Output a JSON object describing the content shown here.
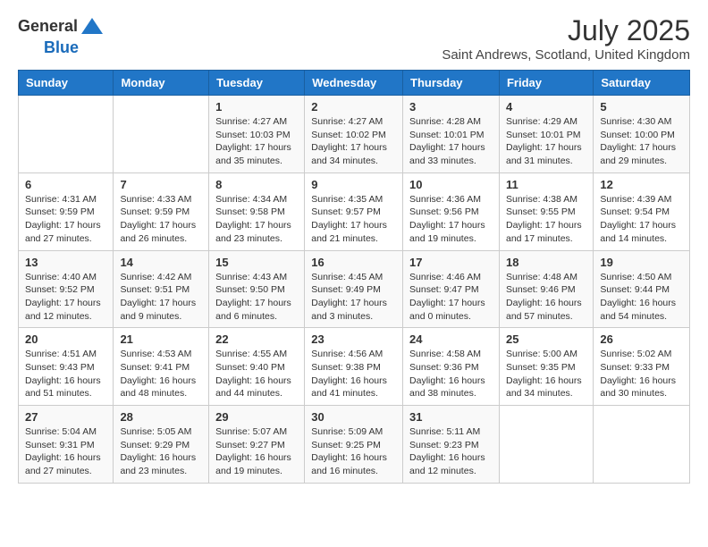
{
  "header": {
    "logo_general": "General",
    "logo_blue": "Blue",
    "month_title": "July 2025",
    "location": "Saint Andrews, Scotland, United Kingdom"
  },
  "calendar": {
    "days_of_week": [
      "Sunday",
      "Monday",
      "Tuesday",
      "Wednesday",
      "Thursday",
      "Friday",
      "Saturday"
    ],
    "weeks": [
      [
        {
          "day": "",
          "sunrise": "",
          "sunset": "",
          "daylight": ""
        },
        {
          "day": "",
          "sunrise": "",
          "sunset": "",
          "daylight": ""
        },
        {
          "day": "1",
          "sunrise": "Sunrise: 4:27 AM",
          "sunset": "Sunset: 10:03 PM",
          "daylight": "Daylight: 17 hours and 35 minutes."
        },
        {
          "day": "2",
          "sunrise": "Sunrise: 4:27 AM",
          "sunset": "Sunset: 10:02 PM",
          "daylight": "Daylight: 17 hours and 34 minutes."
        },
        {
          "day": "3",
          "sunrise": "Sunrise: 4:28 AM",
          "sunset": "Sunset: 10:01 PM",
          "daylight": "Daylight: 17 hours and 33 minutes."
        },
        {
          "day": "4",
          "sunrise": "Sunrise: 4:29 AM",
          "sunset": "Sunset: 10:01 PM",
          "daylight": "Daylight: 17 hours and 31 minutes."
        },
        {
          "day": "5",
          "sunrise": "Sunrise: 4:30 AM",
          "sunset": "Sunset: 10:00 PM",
          "daylight": "Daylight: 17 hours and 29 minutes."
        }
      ],
      [
        {
          "day": "6",
          "sunrise": "Sunrise: 4:31 AM",
          "sunset": "Sunset: 9:59 PM",
          "daylight": "Daylight: 17 hours and 27 minutes."
        },
        {
          "day": "7",
          "sunrise": "Sunrise: 4:33 AM",
          "sunset": "Sunset: 9:59 PM",
          "daylight": "Daylight: 17 hours and 26 minutes."
        },
        {
          "day": "8",
          "sunrise": "Sunrise: 4:34 AM",
          "sunset": "Sunset: 9:58 PM",
          "daylight": "Daylight: 17 hours and 23 minutes."
        },
        {
          "day": "9",
          "sunrise": "Sunrise: 4:35 AM",
          "sunset": "Sunset: 9:57 PM",
          "daylight": "Daylight: 17 hours and 21 minutes."
        },
        {
          "day": "10",
          "sunrise": "Sunrise: 4:36 AM",
          "sunset": "Sunset: 9:56 PM",
          "daylight": "Daylight: 17 hours and 19 minutes."
        },
        {
          "day": "11",
          "sunrise": "Sunrise: 4:38 AM",
          "sunset": "Sunset: 9:55 PM",
          "daylight": "Daylight: 17 hours and 17 minutes."
        },
        {
          "day": "12",
          "sunrise": "Sunrise: 4:39 AM",
          "sunset": "Sunset: 9:54 PM",
          "daylight": "Daylight: 17 hours and 14 minutes."
        }
      ],
      [
        {
          "day": "13",
          "sunrise": "Sunrise: 4:40 AM",
          "sunset": "Sunset: 9:52 PM",
          "daylight": "Daylight: 17 hours and 12 minutes."
        },
        {
          "day": "14",
          "sunrise": "Sunrise: 4:42 AM",
          "sunset": "Sunset: 9:51 PM",
          "daylight": "Daylight: 17 hours and 9 minutes."
        },
        {
          "day": "15",
          "sunrise": "Sunrise: 4:43 AM",
          "sunset": "Sunset: 9:50 PM",
          "daylight": "Daylight: 17 hours and 6 minutes."
        },
        {
          "day": "16",
          "sunrise": "Sunrise: 4:45 AM",
          "sunset": "Sunset: 9:49 PM",
          "daylight": "Daylight: 17 hours and 3 minutes."
        },
        {
          "day": "17",
          "sunrise": "Sunrise: 4:46 AM",
          "sunset": "Sunset: 9:47 PM",
          "daylight": "Daylight: 17 hours and 0 minutes."
        },
        {
          "day": "18",
          "sunrise": "Sunrise: 4:48 AM",
          "sunset": "Sunset: 9:46 PM",
          "daylight": "Daylight: 16 hours and 57 minutes."
        },
        {
          "day": "19",
          "sunrise": "Sunrise: 4:50 AM",
          "sunset": "Sunset: 9:44 PM",
          "daylight": "Daylight: 16 hours and 54 minutes."
        }
      ],
      [
        {
          "day": "20",
          "sunrise": "Sunrise: 4:51 AM",
          "sunset": "Sunset: 9:43 PM",
          "daylight": "Daylight: 16 hours and 51 minutes."
        },
        {
          "day": "21",
          "sunrise": "Sunrise: 4:53 AM",
          "sunset": "Sunset: 9:41 PM",
          "daylight": "Daylight: 16 hours and 48 minutes."
        },
        {
          "day": "22",
          "sunrise": "Sunrise: 4:55 AM",
          "sunset": "Sunset: 9:40 PM",
          "daylight": "Daylight: 16 hours and 44 minutes."
        },
        {
          "day": "23",
          "sunrise": "Sunrise: 4:56 AM",
          "sunset": "Sunset: 9:38 PM",
          "daylight": "Daylight: 16 hours and 41 minutes."
        },
        {
          "day": "24",
          "sunrise": "Sunrise: 4:58 AM",
          "sunset": "Sunset: 9:36 PM",
          "daylight": "Daylight: 16 hours and 38 minutes."
        },
        {
          "day": "25",
          "sunrise": "Sunrise: 5:00 AM",
          "sunset": "Sunset: 9:35 PM",
          "daylight": "Daylight: 16 hours and 34 minutes."
        },
        {
          "day": "26",
          "sunrise": "Sunrise: 5:02 AM",
          "sunset": "Sunset: 9:33 PM",
          "daylight": "Daylight: 16 hours and 30 minutes."
        }
      ],
      [
        {
          "day": "27",
          "sunrise": "Sunrise: 5:04 AM",
          "sunset": "Sunset: 9:31 PM",
          "daylight": "Daylight: 16 hours and 27 minutes."
        },
        {
          "day": "28",
          "sunrise": "Sunrise: 5:05 AM",
          "sunset": "Sunset: 9:29 PM",
          "daylight": "Daylight: 16 hours and 23 minutes."
        },
        {
          "day": "29",
          "sunrise": "Sunrise: 5:07 AM",
          "sunset": "Sunset: 9:27 PM",
          "daylight": "Daylight: 16 hours and 19 minutes."
        },
        {
          "day": "30",
          "sunrise": "Sunrise: 5:09 AM",
          "sunset": "Sunset: 9:25 PM",
          "daylight": "Daylight: 16 hours and 16 minutes."
        },
        {
          "day": "31",
          "sunrise": "Sunrise: 5:11 AM",
          "sunset": "Sunset: 9:23 PM",
          "daylight": "Daylight: 16 hours and 12 minutes."
        },
        {
          "day": "",
          "sunrise": "",
          "sunset": "",
          "daylight": ""
        },
        {
          "day": "",
          "sunrise": "",
          "sunset": "",
          "daylight": ""
        }
      ]
    ]
  }
}
